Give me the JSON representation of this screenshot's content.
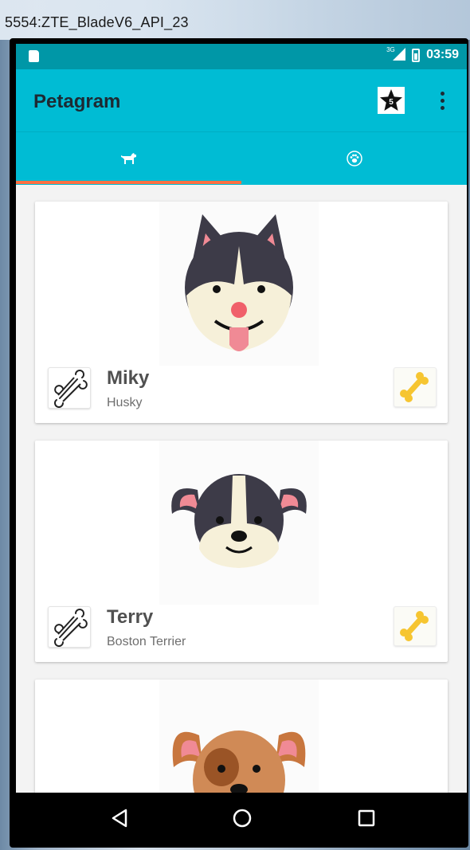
{
  "window": {
    "title": "5554:ZTE_BladeV6_API_23"
  },
  "statusbar": {
    "network": "3G",
    "time": "03:59"
  },
  "appbar": {
    "title": "Petagram",
    "favorites_icon": "star-icon",
    "favorites_count": "5",
    "overflow_icon": "more-vert-icon"
  },
  "tabs": [
    {
      "icon": "dog-icon",
      "selected": true
    },
    {
      "icon": "paw-icon",
      "selected": false
    }
  ],
  "pets": [
    {
      "name": "Miky",
      "breed": "Husky",
      "photo": "husky-face-icon",
      "like_icon": "bone-outline-icon",
      "rating_icon": "bone-yellow-icon"
    },
    {
      "name": "Terry",
      "breed": "Boston Terrier",
      "photo": "boston-terrier-face-icon",
      "like_icon": "bone-outline-icon",
      "rating_icon": "bone-yellow-icon"
    },
    {
      "name": "",
      "breed": "",
      "photo": "brown-dog-face-icon"
    }
  ],
  "navbar": {
    "back_icon": "back-triangle-icon",
    "home_icon": "home-circle-icon",
    "recents_icon": "recents-square-icon"
  },
  "colors": {
    "primary": "#00bcd4",
    "primary_dark": "#0097a7",
    "accent": "#ff7043",
    "bone_yellow": "#f6c531"
  }
}
